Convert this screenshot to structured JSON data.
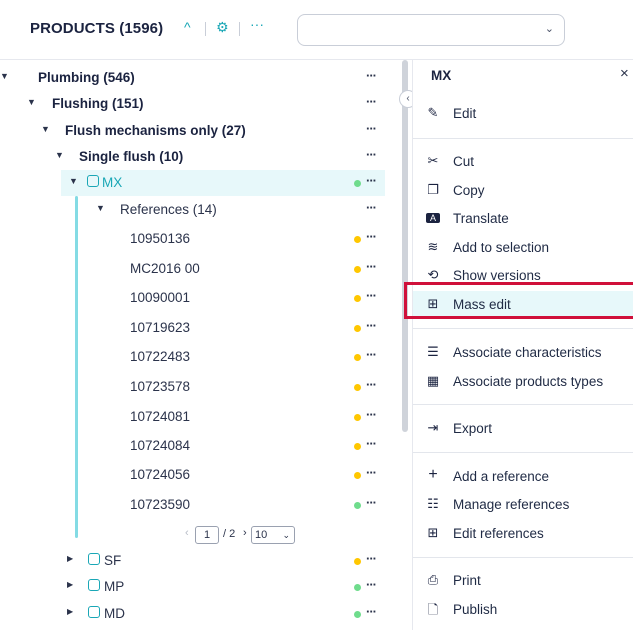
{
  "header": {
    "title": "PRODUCTS (1596)",
    "dropdown_value": ""
  },
  "tree": {
    "rows": [
      {
        "label": "Plumbing (546)"
      },
      {
        "label": "Flushing (151)"
      },
      {
        "label": "Flush mechanisms only (27)"
      },
      {
        "label": "Single flush (10)"
      },
      {
        "label": "MX",
        "status": "green"
      },
      {
        "label": "References (14)"
      },
      {
        "label": "10950136",
        "status": "yellow"
      },
      {
        "label": "MC2016 00",
        "status": "yellow"
      },
      {
        "label": "10090001",
        "status": "yellow"
      },
      {
        "label": "10719623",
        "status": "yellow"
      },
      {
        "label": "10722483",
        "status": "yellow"
      },
      {
        "label": "10723578",
        "status": "yellow"
      },
      {
        "label": "10724081",
        "status": "yellow"
      },
      {
        "label": "10724084",
        "status": "yellow"
      },
      {
        "label": "10724056",
        "status": "yellow"
      },
      {
        "label": "10723590",
        "status": "green"
      },
      {
        "label": "SF",
        "status": "yellow"
      },
      {
        "label": "MP",
        "status": "green"
      },
      {
        "label": "MD",
        "status": "green"
      }
    ],
    "pager": {
      "page": "1",
      "total": "/ 2",
      "per_page": "10"
    }
  },
  "menu": {
    "title": "MX",
    "items": [
      {
        "label": "Edit",
        "icon": "pencil-icon"
      },
      {
        "label": "Cut",
        "icon": "scissors-icon"
      },
      {
        "label": "Copy",
        "icon": "copy-icon"
      },
      {
        "label": "Translate",
        "icon": "translate-icon"
      },
      {
        "label": "Add to selection",
        "icon": "layers-icon"
      },
      {
        "label": "Show versions",
        "icon": "history-icon"
      },
      {
        "label": "Mass edit",
        "icon": "table-icon"
      },
      {
        "label": "Associate characteristics",
        "icon": "checklist-icon"
      },
      {
        "label": "Associate products types",
        "icon": "grid-icon"
      },
      {
        "label": "Export",
        "icon": "export-icon"
      },
      {
        "label": "Add a reference",
        "icon": "plus-icon"
      },
      {
        "label": "Manage references",
        "icon": "list-icon"
      },
      {
        "label": "Edit references",
        "icon": "table-icon"
      },
      {
        "label": "Print",
        "icon": "printer-icon"
      },
      {
        "label": "Publish",
        "icon": "pdf-icon"
      }
    ]
  },
  "colors": {
    "accent": "#1aa7b6",
    "highlight": "#e7f8fa",
    "status_green": "#6fdc8c",
    "status_yellow": "#ffc700",
    "callout_red": "#d0103a"
  }
}
